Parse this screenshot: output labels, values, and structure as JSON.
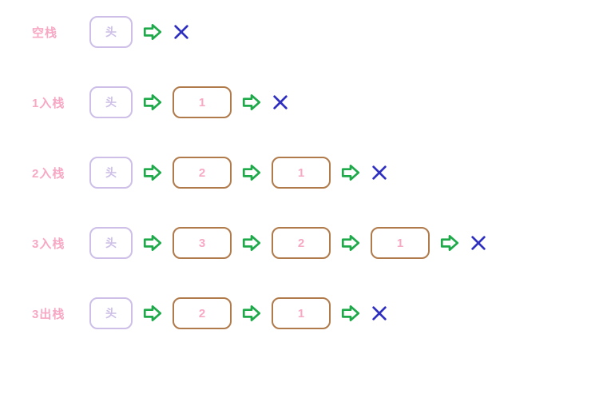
{
  "head_label": "头",
  "rows": [
    {
      "label": "空栈",
      "nodes": []
    },
    {
      "label": "1入栈",
      "nodes": [
        "1"
      ]
    },
    {
      "label": "2入栈",
      "nodes": [
        "2",
        "1"
      ]
    },
    {
      "label": "3入栈",
      "nodes": [
        "3",
        "2",
        "1"
      ]
    },
    {
      "label": "3出栈",
      "nodes": [
        "2",
        "1"
      ]
    }
  ],
  "icons": {
    "arrow": "arrow-right-icon",
    "null": "cross-icon"
  },
  "colors": {
    "label": "#f7a8c4",
    "head_border": "#cdbfe7",
    "node_border": "#b07a4a",
    "node_text": "#f7a8c4",
    "arrow": "#1fa94b",
    "cross": "#3030c0"
  }
}
